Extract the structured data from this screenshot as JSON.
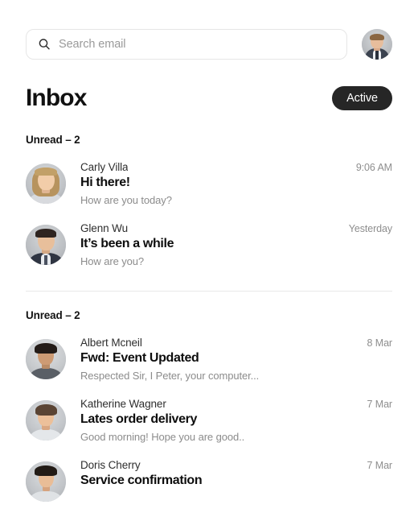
{
  "search": {
    "placeholder": "Search email",
    "value": "",
    "icon": "search-icon"
  },
  "account": {
    "avatar_alt": "account-avatar"
  },
  "header": {
    "title": "Inbox",
    "status_label": "Active",
    "status_color": "#262626"
  },
  "sections": [
    {
      "label": "Unread – 2",
      "emails": [
        {
          "sender": "Carly Villa",
          "subject": "Hi there!",
          "preview": "How are you today?",
          "timestamp": "9:06 AM"
        },
        {
          "sender": "Glenn Wu",
          "subject": "It’s been a while",
          "preview": "How are you?",
          "timestamp": "Yesterday"
        }
      ]
    },
    {
      "label": "Unread – 2",
      "emails": [
        {
          "sender": "Albert Mcneil",
          "subject": "Fwd: Event Updated",
          "preview": "Respected Sir, I Peter, your computer...",
          "timestamp": "8 Mar"
        },
        {
          "sender": "Katherine Wagner",
          "subject": "Lates order delivery",
          "preview": "Good morning! Hope you are good..",
          "timestamp": "7 Mar"
        },
        {
          "sender": "Doris Cherry",
          "subject": "Service confirmation",
          "preview": "",
          "timestamp": "7 Mar"
        }
      ]
    }
  ]
}
